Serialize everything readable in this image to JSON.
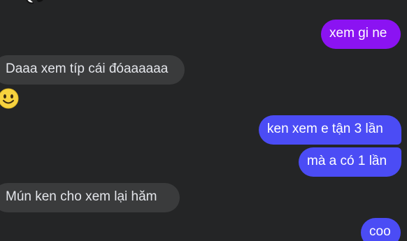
{
  "messages": [
    {
      "id": "m1",
      "side": "outgoing",
      "text": "xem gi ne",
      "color": "#8b13f2"
    },
    {
      "id": "m2",
      "side": "incoming",
      "text": "Daaa xem típ cái đóaaaaaa"
    },
    {
      "id": "m3",
      "side": "incoming",
      "emoji": "smiling-face-emoji"
    },
    {
      "id": "m4",
      "side": "outgoing",
      "text": "ken xem e tận 3 lần",
      "color": "#4b4cf5"
    },
    {
      "id": "m5",
      "side": "outgoing",
      "text": "mà a có 1 lần",
      "color": "#4b4cf5"
    },
    {
      "id": "m6",
      "side": "incoming",
      "text": "Mún ken cho xem lại hăm"
    },
    {
      "id": "m7",
      "side": "outgoing",
      "text": "coo",
      "color": "#4b4cf5"
    }
  ],
  "colors": {
    "background": "#242526",
    "incoming_bubble": "#3a3b3c",
    "outgoing_purple": "#8b13f2",
    "outgoing_blue": "#4b4cf5"
  }
}
